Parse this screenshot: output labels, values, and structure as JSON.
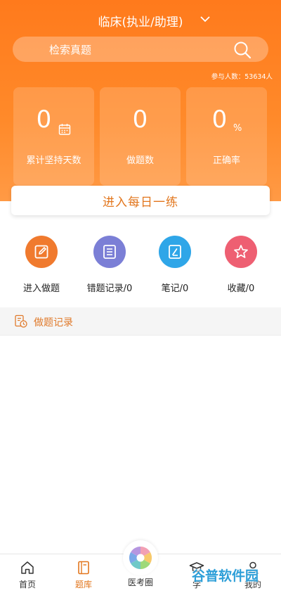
{
  "header": {
    "title": "临床(执业/助理)",
    "search_placeholder": "检索真题",
    "participants": "参与人数：53634人"
  },
  "stats": [
    {
      "value": "0",
      "label": "累计坚持天数"
    },
    {
      "value": "0",
      "label": "做题数"
    },
    {
      "value": "0",
      "unit": "%",
      "label": "正确率"
    }
  ],
  "daily_button": "进入每日一练",
  "actions": [
    {
      "label": "进入做题",
      "icon": "edit-icon",
      "color": "#f07a2e"
    },
    {
      "label": "错题记录/0",
      "icon": "list-icon",
      "color": "#7b7fd6"
    },
    {
      "label": "笔记/0",
      "icon": "note-icon",
      "color": "#2fa6e8"
    },
    {
      "label": "收藏/0",
      "icon": "star-icon",
      "color": "#ee5f72"
    }
  ],
  "records_label": "做题记录",
  "tabbar": {
    "home": "首页",
    "question_bank": "题库",
    "circle": "医考圈",
    "learn": "学",
    "mine": "我的"
  },
  "watermark": "谷普软件园",
  "colors": {
    "brand": "#ff7a1c",
    "accent_text": "#e2761d"
  }
}
